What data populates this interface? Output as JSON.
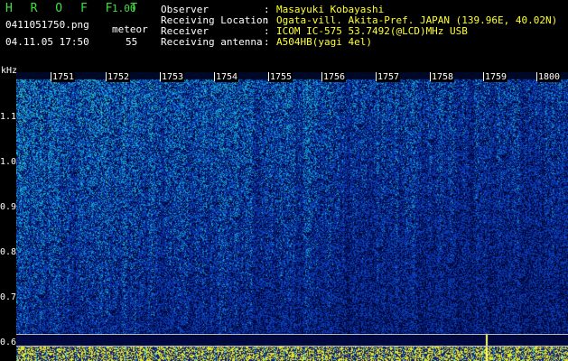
{
  "app": {
    "title": "H R O F F T",
    "version": "1.00",
    "filename": "0411051750.png",
    "datetime": "04.11.05 17:50",
    "counter_label": "meteor",
    "counter_value": "55"
  },
  "info": [
    {
      "label": "Observer",
      "value": "Masayuki Kobayashi"
    },
    {
      "label": "Receiving Location",
      "value": "Ogata-vill. Akita-Pref. JAPAN (139.96E, 40.02N)"
    },
    {
      "label": "Receiver",
      "value": "ICOM IC-575 53.7492(@LCD)MHz USB"
    },
    {
      "label": "Receiving antenna",
      "value": "A504HB(yagi 4el)"
    }
  ],
  "axis": {
    "unit": "kHz",
    "freq_labels": [
      "1.1",
      "1.0",
      "0.9",
      "0.8",
      "0.7",
      "0.6"
    ],
    "minute_labels": [
      "1751",
      "1752",
      "1753",
      "1754",
      "1755",
      "1756",
      "1757",
      "1758",
      "1759",
      "1800"
    ]
  },
  "colors": {
    "background": "#000000",
    "label_green": "#3fe03f",
    "value_yellow": "#ffff33",
    "text_white": "#ffffff",
    "spectro_low": "#0a1a6e",
    "spectro_mid": "#1e50d0",
    "spectro_high": "#3fe0b0"
  }
}
